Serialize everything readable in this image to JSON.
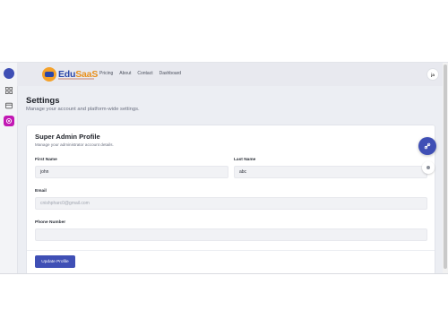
{
  "rail": {
    "items": [
      {
        "icon": "grid-icon"
      },
      {
        "icon": "card-icon"
      },
      {
        "icon": "gear-icon",
        "active": true
      }
    ]
  },
  "brand": {
    "part1": "Edu",
    "part2": "SaaS"
  },
  "nav": {
    "links": [
      "Pricing",
      "About",
      "Contact",
      "Dashboard"
    ]
  },
  "user": {
    "initials": "ja"
  },
  "page": {
    "title": "Settings",
    "subtitle": "Manage your account and platform-wide settings."
  },
  "profile_card": {
    "title": "Super Admin Profile",
    "subtitle": "Manage your administrator account details.",
    "first_name_label": "First Name",
    "first_name_value": "john",
    "last_name_label": "Last Name",
    "last_name_value": "abc",
    "email_label": "Email",
    "email_value": "cnishpharc0@gmail.com",
    "phone_label": "Phone Number",
    "phone_value": "",
    "update_label": "Update Profile"
  },
  "colors": {
    "accent": "#3f4fb5",
    "active_rail": "#c218b4",
    "brand_orange": "#e8901d"
  }
}
